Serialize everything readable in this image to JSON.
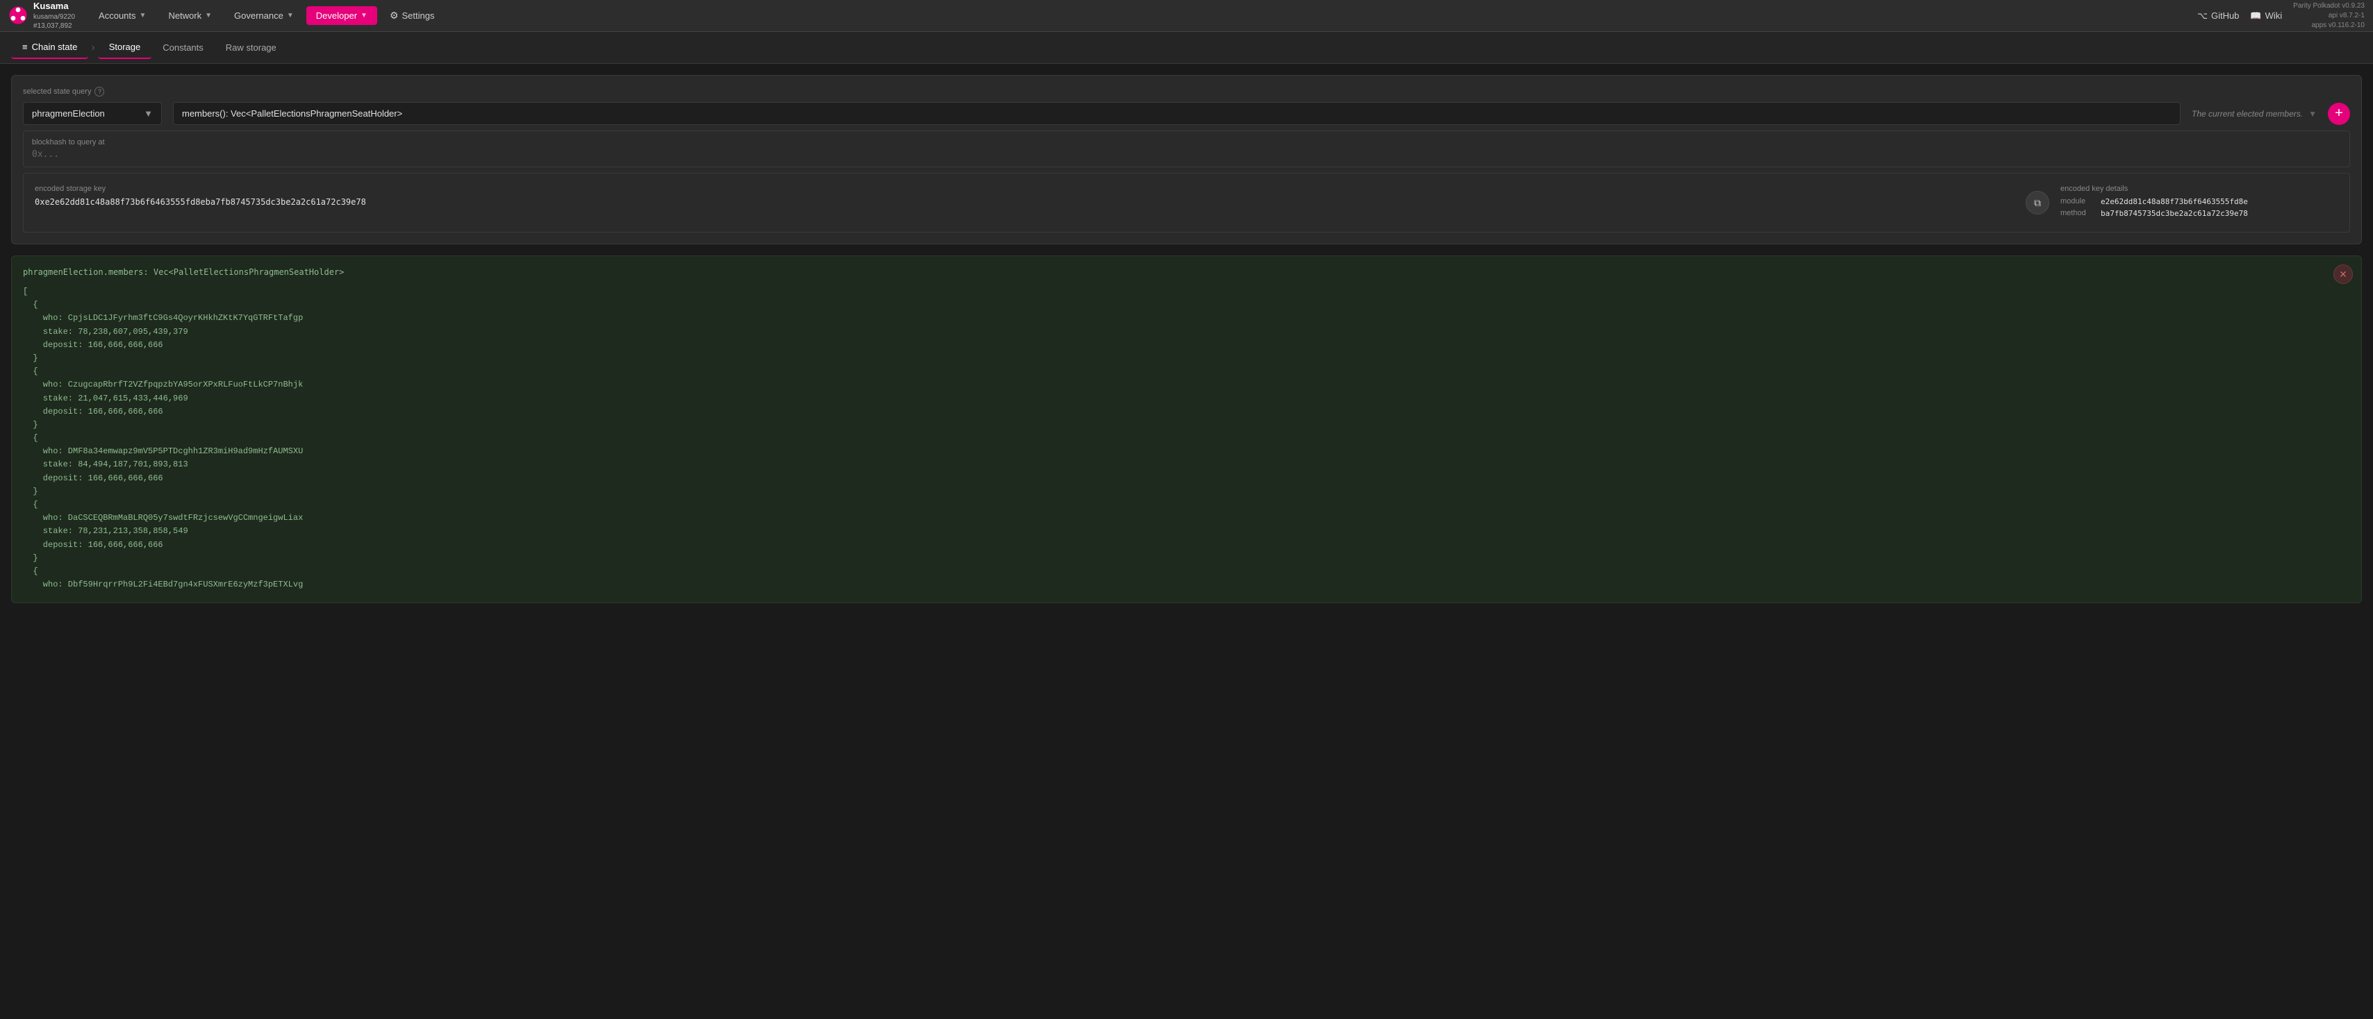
{
  "app": {
    "version_parity": "Parity Polkadot v0.9.23",
    "version_api": "api v8.7.2-1",
    "version_apps": "apps v0.116.2-10"
  },
  "nav": {
    "brand_name": "Kusama",
    "brand_sub": "kusama/9220",
    "brand_block": "#13,037,892",
    "items": [
      {
        "label": "Accounts",
        "active": false
      },
      {
        "label": "Network",
        "active": false
      },
      {
        "label": "Governance",
        "active": false
      },
      {
        "label": "Developer",
        "active": true
      },
      {
        "label": "Settings",
        "active": false
      }
    ],
    "github_label": "GitHub",
    "wiki_label": "Wiki"
  },
  "subnav": {
    "group_label": "Chain state",
    "tabs": [
      {
        "label": "Storage",
        "active": true
      },
      {
        "label": "Constants",
        "active": false
      },
      {
        "label": "Raw storage",
        "active": false
      }
    ]
  },
  "query": {
    "label": "selected state query",
    "module_value": "phragmenElection",
    "method_value": "members(): Vec<PalletElectionsPhragmenSeatHolder>",
    "description": "The current elected members.",
    "blockhash_label": "blockhash to query at",
    "blockhash_placeholder": "0x..."
  },
  "encoded_key": {
    "label": "encoded storage key",
    "value": "0xe2e62dd81c48a88f73b6f6463555fd8eba7fb8745735dc3be2a2c61a72c39e78",
    "details_label": "encoded key details",
    "module_label": "module",
    "module_value": "e2e62dd81c48a88f73b6f6463555fd8e",
    "method_label": "method",
    "method_value": "ba7fb8745735dc3be2a2c61a72c39e78"
  },
  "result": {
    "header": "phragmenElection.members: Vec<PalletElectionsPhragmenSeatHolder>",
    "content": "[\n  {\n    who: CpjsLDC1JFyrhm3ftC9Gs4QoyrKHkhZKtK7YqGTRFtTafgp\n    stake: 78,238,607,095,439,379\n    deposit: 166,666,666,666\n  }\n  {\n    who: CzugcapRbrfT2VZfpqpzbYA95orXPxRLFuoFtLkCP7nBhjk\n    stake: 21,047,615,433,446,969\n    deposit: 166,666,666,666\n  }\n  {\n    who: DMF8a34emwapz9mV5P5PTDcghh1ZR3miH9ad9mHzfAUMSXU\n    stake: 84,494,187,701,893,813\n    deposit: 166,666,666,666\n  }\n  {\n    who: DaCSCEQBRmMaBLRQ05y7swdtFRzjcsewVgCCmngeigwLiax\n    stake: 78,231,213,358,858,549\n    deposit: 166,666,666,666\n  }\n  {\n    who: Dbf59HrqrrPh9L2Fi4EBd7gn4xFUSXmrE6zyMzf3pETXLvg"
  }
}
